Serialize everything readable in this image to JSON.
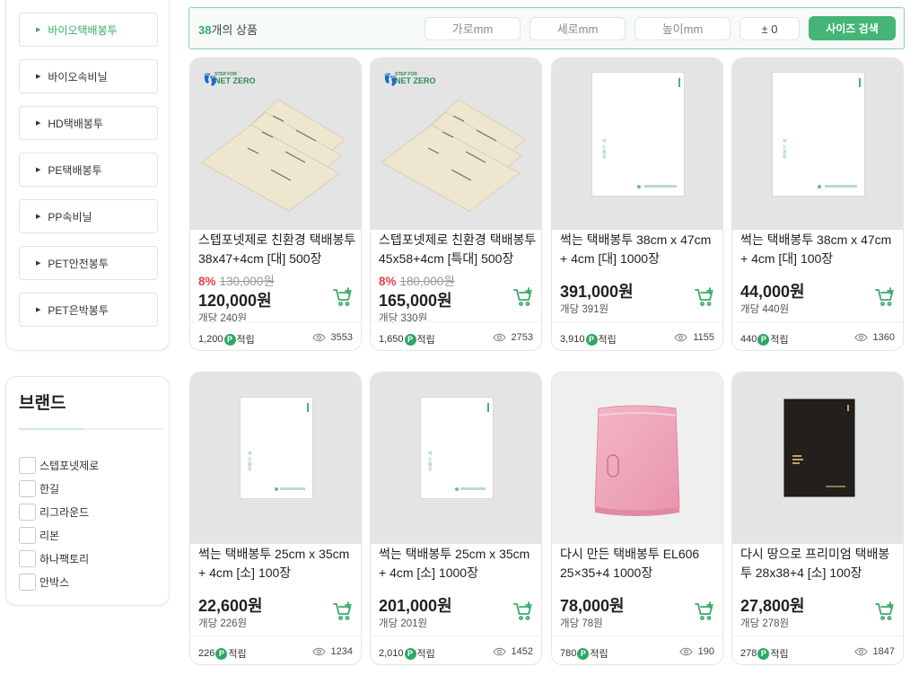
{
  "sidebar": {
    "categories": [
      {
        "label": "바이오택배봉투",
        "active": true
      },
      {
        "label": "바이오속비닐",
        "active": false
      },
      {
        "label": "HD택배봉투",
        "active": false
      },
      {
        "label": "PE택배봉투",
        "active": false
      },
      {
        "label": "PP속비닐",
        "active": false
      },
      {
        "label": "PET안전봉투",
        "active": false
      },
      {
        "label": "PET은박봉투",
        "active": false
      }
    ],
    "brand_title": "브랜드",
    "brands": [
      "스텝포넷제로",
      "한길",
      "리그라운드",
      "리본",
      "하나팩토리",
      "안박스"
    ]
  },
  "search_bar": {
    "count_number": "38",
    "count_suffix": "개의 상품",
    "width_placeholder": "가로mm",
    "length_placeholder": "세로mm",
    "height_placeholder": "높이mm",
    "tolerance": "± 0",
    "search_button": "사이즈 검색"
  },
  "products": [
    {
      "name": "스텝포넷제로 친환경 택배봉투 38x47+4cm [대] 500장",
      "discount_pct": "8%",
      "original_price": "130,000원",
      "price": "120,000원",
      "unit_price": "개당 240원",
      "points": "1,200",
      "points_suffix": "적립",
      "views": "3553",
      "image": "netzero-kraft-bags",
      "badge_small": "STEP FOR",
      "badge_big": "NET ZERO"
    },
    {
      "name": "스텝포넷제로 친환경 택배봉투 45x58+4cm [특대] 500장",
      "discount_pct": "8%",
      "original_price": "180,000원",
      "price": "165,000원",
      "unit_price": "개당 330원",
      "points": "1,650",
      "points_suffix": "적립",
      "views": "2753",
      "image": "netzero-kraft-bags",
      "badge_small": "STEP FOR",
      "badge_big": "NET ZERO"
    },
    {
      "name": "썩는 택배봉투 38cm x 47cm + 4cm [대] 1000장",
      "price": "391,000원",
      "unit_price": "개당 391원",
      "points": "3,910",
      "points_suffix": "적립",
      "views": "1155",
      "image": "white-bag"
    },
    {
      "name": "썩는 택배봉투 38cm x 47cm + 4cm [대] 100장",
      "price": "44,000원",
      "unit_price": "개당 440원",
      "points": "440",
      "points_suffix": "적립",
      "views": "1360",
      "image": "white-bag"
    },
    {
      "name": "썩는 택배봉투 25cm x 35cm + 4cm [소] 100장",
      "price": "22,600원",
      "unit_price": "개당 226원",
      "points": "226",
      "points_suffix": "적립",
      "views": "1234",
      "image": "white-bag-small"
    },
    {
      "name": "썩는 택배봉투 25cm x 35cm + 4cm [소] 1000장",
      "price": "201,000원",
      "unit_price": "개당 201원",
      "points": "2,010",
      "points_suffix": "적립",
      "views": "1452",
      "image": "white-bag-small"
    },
    {
      "name": "다시 만든 택배봉투 EL606 25×35+4  1000장",
      "price": "78,000원",
      "unit_price": "개당 78원",
      "points": "780",
      "points_suffix": "적립",
      "views": "190",
      "image": "pink-bag"
    },
    {
      "name": "다시 땅으로 프리미엄 택배봉투 28x38+4 [소] 100장",
      "price": "27,800원",
      "unit_price": "개당 278원",
      "points": "278",
      "points_suffix": "적립",
      "views": "1847",
      "image": "black-bag"
    }
  ],
  "point_badge_letter": "P",
  "colors": {
    "accent": "#44b577",
    "discount": "#e0424b",
    "border_accent": "#8fd1ad"
  }
}
